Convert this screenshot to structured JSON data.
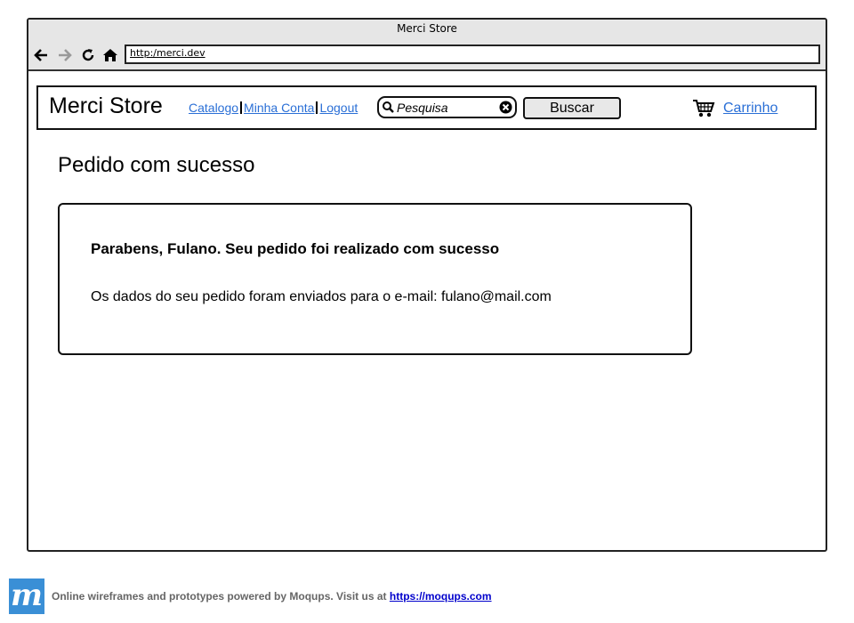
{
  "window": {
    "title": "Merci Store"
  },
  "browser": {
    "url": "http:/merci.dev",
    "icons": {
      "back": "arrow-left-icon",
      "forward": "arrow-right-icon",
      "reload": "reload-icon",
      "home": "home-icon"
    }
  },
  "header": {
    "brand": "Merci Store",
    "nav": [
      "Catalogo",
      "Minha Conta",
      "Logout"
    ],
    "search": {
      "placeholder": "Pesquisa",
      "button": "Buscar"
    },
    "cart": {
      "label": "Carrinho",
      "icon": "cart-icon"
    }
  },
  "main": {
    "title": "Pedido com sucesso",
    "card": {
      "heading": "Parabens, Fulano. Seu pedido foi realizado com sucesso",
      "message": "Os dados do seu pedido foram enviados para o e-mail: fulano@mail.com"
    }
  },
  "footer": {
    "logo_letter": "m",
    "text": "Online wireframes and prototypes powered by Moqups. Visit us at",
    "link": "https://moqups.com"
  },
  "colors": {
    "link": "#2a6fd6",
    "chrome": "#e6e6e6",
    "logo": "#3a8fd6"
  }
}
